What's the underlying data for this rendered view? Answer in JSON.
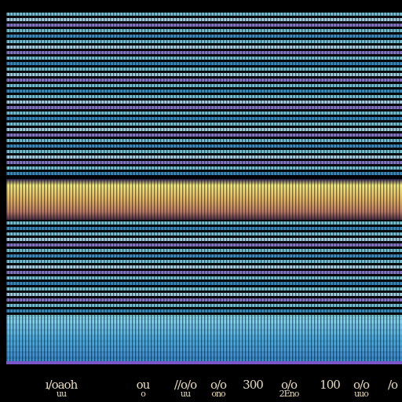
{
  "colors": {
    "background": "#000000",
    "cyan": "#7fe4f2",
    "pale_cyan": "#b8f2ff",
    "violet": "#9c8ae6",
    "gold": "#f0d25a",
    "orange": "#e2a06a",
    "blue": "#3aa4de",
    "tick_text": "#e8dcc0"
  },
  "axis": {
    "ticks": [
      {
        "top": "ı/oaoh",
        "bottom": "uu"
      },
      {
        "top": "ou",
        "bottom": "o"
      },
      {
        "top": "//o/o",
        "bottom": "uu"
      },
      {
        "top": "o/o",
        "bottom": "ono"
      },
      {
        "top": "300",
        "bottom": ""
      },
      {
        "top": "o/o",
        "bottom": "2Eno"
      },
      {
        "top": "100",
        "bottom": ""
      },
      {
        "top": "o/o",
        "bottom": "uuo"
      },
      {
        "top": "/o",
        "bottom": ""
      }
    ]
  }
}
